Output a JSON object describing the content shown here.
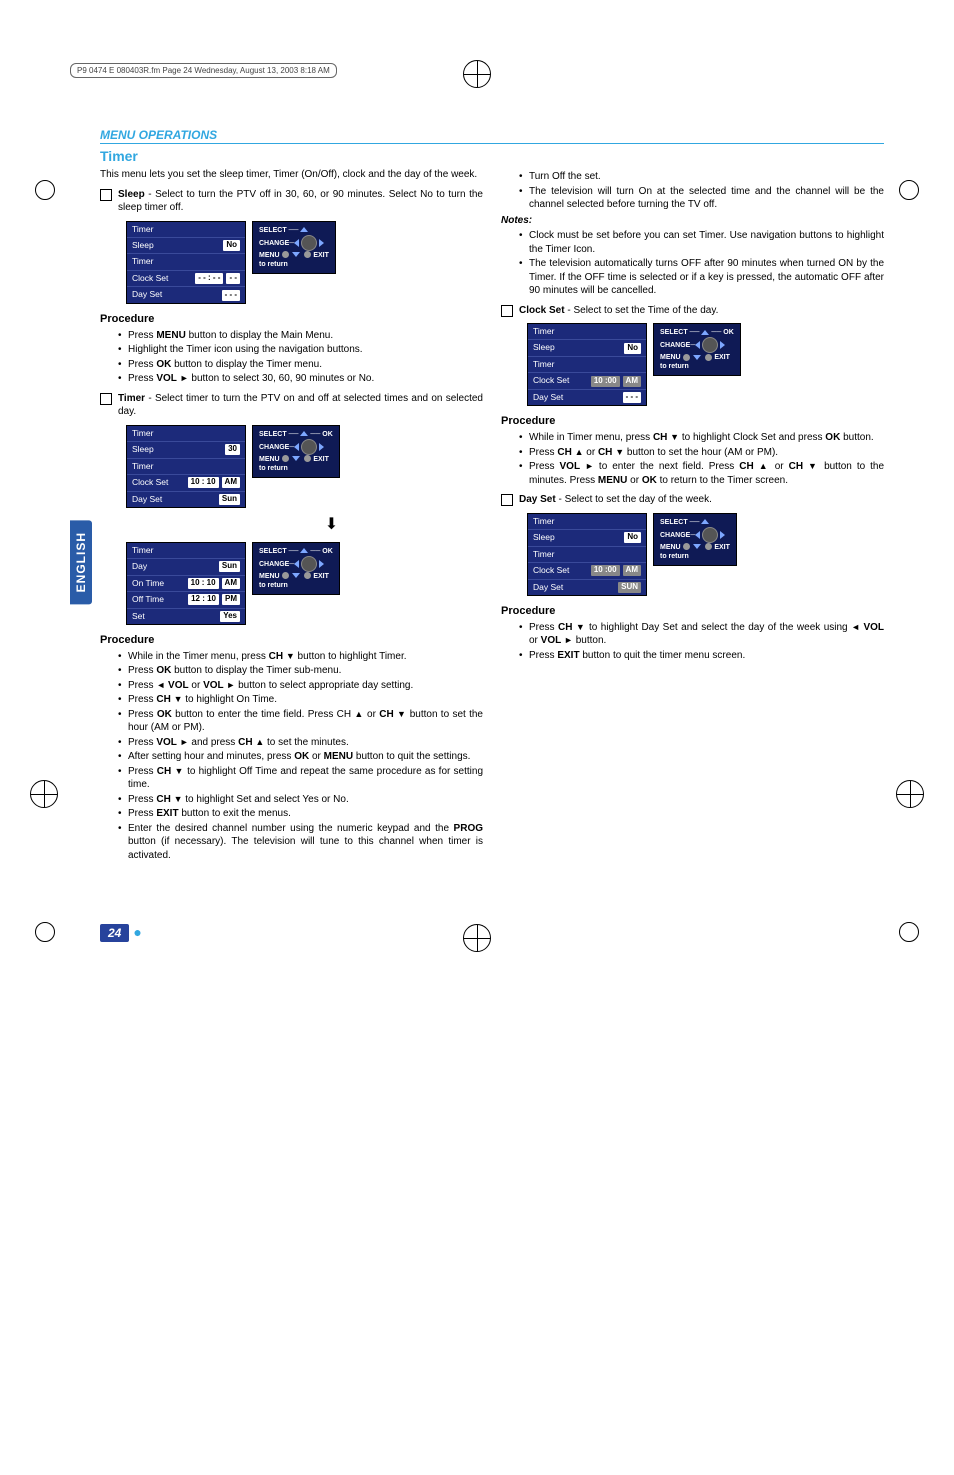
{
  "doc_header": "P9 0474 E  080403R.fm  Page 24  Wednesday, August 13, 2003  8:18 AM",
  "section_bar": "MENU OPERATIONS",
  "side_tab": "ENGLISH",
  "page_number": "24",
  "timer": {
    "heading": "Timer",
    "intro": "This menu lets you set the sleep timer, Timer (On/Off), clock and the day of the week.",
    "sleep_item": "Sleep",
    "sleep_desc": " - Select to turn the PTV off in 30, 60, or 90 minutes. Select No to turn the sleep timer off.",
    "proc_label": "Procedure",
    "proc1": [
      "Press MENU button to display the Main Menu.",
      "Highlight the Timer icon using the navigation buttons.",
      "Press OK button to display the Timer menu.",
      "Press VOL ► button to select 30, 60, 90 minutes or No."
    ],
    "timer_item": "Timer",
    "timer_desc": "  - Select timer to turn the PTV on and off at selected times and on selected day.",
    "proc2": [
      "While in the Timer menu, press CH ▼ button to highlight Timer.",
      "Press OK button to display the Timer sub-menu.",
      "Press ◄ VOL or VOL ► button to select appropriate day setting.",
      "Press CH ▼ to highlight On Time.",
      "Press OK button to enter the time field. Press CH ▲ or CH ▼ button to set the hour (AM or PM).",
      "Press VOL ► and press CH ▲ to set the minutes.",
      "After setting hour and minutes, press OK or MENU button to quit the settings.",
      "Press CH ▼ to highlight Off Time and repeat the same procedure as for setting time.",
      "Press CH ▼ to highlight Set and select Yes or No.",
      "Press EXIT button to exit the menus.",
      "Enter the desired channel number using the numeric keypad and the PROG button (if necessary). The television will tune to this channel when timer is activated."
    ]
  },
  "right": {
    "top_items": [
      "Turn Off the set.",
      "The television will turn On at the selected time and the channel will be the channel selected before turning the TV off."
    ],
    "notes_label": "Notes:",
    "notes": [
      "Clock must be set before you can set Timer. Use navigation buttons to highlight the Timer Icon.",
      "The television automatically turns OFF after 90 minutes when turned ON by the Timer. If the OFF time is selected or if a key is pressed, the automatic OFF after 90 minutes will be cancelled."
    ],
    "clockset_item": "Clock Set",
    "clockset_desc": " - Select to set the Time of the day.",
    "proc_label": "Procedure",
    "proc3": [
      "While in Timer menu, press CH ▼ to highlight Clock Set and press OK button.",
      "Press CH ▲ or CH ▼ button to set the hour (AM or PM).",
      "Press VOL ► to enter the next field. Press CH ▲ or CH ▼ button to the minutes. Press MENU or OK to return to the Timer screen."
    ],
    "dayset_item": "Day Set",
    "dayset_desc": " - Select to set the day of the week.",
    "proc4": [
      "Press CH ▼ to highlight Day Set and select the day of the week using ◄ VOL or VOL ► button.",
      "Press EXIT button to quit the timer menu screen."
    ]
  },
  "osd": {
    "rows": {
      "timer": "Timer",
      "sleep": "Sleep",
      "clock_set": "Clock Set",
      "day_set": "Day Set",
      "day": "Day",
      "on_time": "On Time",
      "off_time": "Off Time",
      "set": "Set"
    },
    "vals": {
      "no": "No",
      "dashes_time": "- - : - -",
      "dashes_ampm": "- -",
      "dashes3": "- - -",
      "thirty": "30",
      "ten_ten": "10 : 10",
      "twelve_ten": "12 : 10",
      "am": "AM",
      "pm": "PM",
      "sun": "Sun",
      "sun_caps": "SUN",
      "yes": "Yes",
      "ten_zero": "10 :00"
    },
    "side": {
      "select": "SELECT",
      "change": "CHANGE",
      "menu": "MENU",
      "to_return": "to return",
      "exit": "EXIT",
      "ok": "OK"
    }
  }
}
